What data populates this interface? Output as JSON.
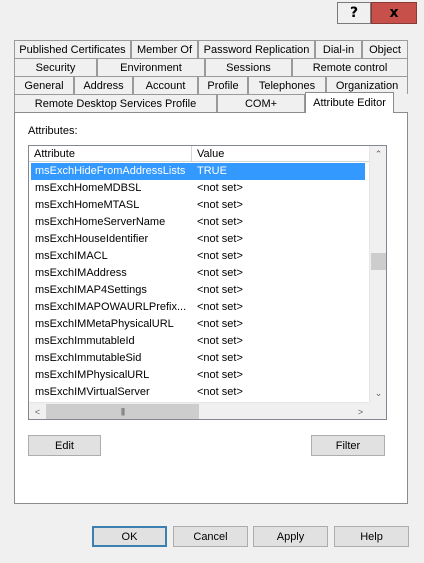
{
  "titlebar": {
    "help_label": "?",
    "close_label": "x"
  },
  "tabs": {
    "row1": [
      "Published Certificates",
      "Member Of",
      "Password Replication",
      "Dial-in",
      "Object"
    ],
    "row2": [
      "Security",
      "Environment",
      "Sessions",
      "Remote control"
    ],
    "row3": [
      "General",
      "Address",
      "Account",
      "Profile",
      "Telephones",
      "Organization"
    ],
    "row4": [
      "Remote Desktop Services Profile",
      "COM+",
      "Attribute Editor"
    ],
    "active": "Attribute Editor"
  },
  "attributes": {
    "label": "Attributes:",
    "columns": [
      "Attribute",
      "Value"
    ],
    "rows": [
      {
        "attribute": "msExchHideFromAddressLists",
        "value": "TRUE",
        "selected": true
      },
      {
        "attribute": "msExchHomeMDBSL",
        "value": "<not set>"
      },
      {
        "attribute": "msExchHomeMTASL",
        "value": "<not set>"
      },
      {
        "attribute": "msExchHomeServerName",
        "value": "<not set>"
      },
      {
        "attribute": "msExchHouseIdentifier",
        "value": "<not set>"
      },
      {
        "attribute": "msExchIMACL",
        "value": "<not set>"
      },
      {
        "attribute": "msExchIMAddress",
        "value": "<not set>"
      },
      {
        "attribute": "msExchIMAP4Settings",
        "value": "<not set>"
      },
      {
        "attribute": "msExchIMAPOWAURLPrefix...",
        "value": "<not set>"
      },
      {
        "attribute": "msExchIMMetaPhysicalURL",
        "value": "<not set>"
      },
      {
        "attribute": "msExchImmutableId",
        "value": "<not set>"
      },
      {
        "attribute": "msExchImmutableSid",
        "value": "<not set>"
      },
      {
        "attribute": "msExchIMPhysicalURL",
        "value": "<not set>"
      },
      {
        "attribute": "msExchIMVirtualServer",
        "value": "<not set>"
      }
    ]
  },
  "actions": {
    "edit": "Edit",
    "filter": "Filter"
  },
  "footer": {
    "ok": "OK",
    "cancel": "Cancel",
    "apply": "Apply",
    "help": "Help"
  },
  "colors": {
    "selection": "#3399ff",
    "close_button": "#c7504b",
    "default_button_border": "#3c7fb1"
  },
  "icons": {
    "scroll_up": "chevron-up-icon",
    "scroll_down": "chevron-down-icon",
    "scroll_left": "chevron-left-icon",
    "scroll_right": "chevron-right-icon",
    "grip": "grip-icon"
  }
}
